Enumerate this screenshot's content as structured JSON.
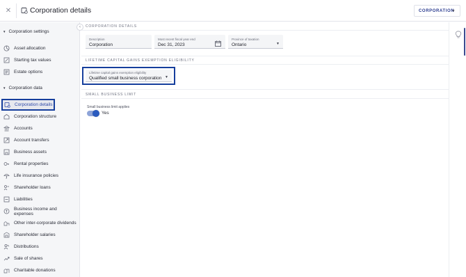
{
  "header": {
    "title": "Corporation details",
    "entity_select": "CORPORATION"
  },
  "sidebar": {
    "sections": [
      {
        "label": "Corporation settings",
        "items": [
          {
            "label": "Asset allocation",
            "icon": "asset-allocation-icon"
          },
          {
            "label": "Starting tax values",
            "icon": "tax-values-icon"
          },
          {
            "label": "Estate options",
            "icon": "estate-options-icon"
          }
        ]
      },
      {
        "label": "Corporation data",
        "items": [
          {
            "label": "Corporation details",
            "icon": "corporation-details-icon",
            "active": true
          },
          {
            "label": "Corporation structure",
            "icon": "structure-icon"
          },
          {
            "label": "Accounts",
            "icon": "accounts-icon"
          },
          {
            "label": "Account transfers",
            "icon": "transfers-icon"
          },
          {
            "label": "Business assets",
            "icon": "business-assets-icon"
          },
          {
            "label": "Rental properties",
            "icon": "rental-icon"
          },
          {
            "label": "Life insurance policies",
            "icon": "insurance-icon"
          },
          {
            "label": "Shareholder loans",
            "icon": "loans-icon"
          },
          {
            "label": "Liabilities",
            "icon": "liabilities-icon"
          },
          {
            "label": "Business income and expenses",
            "icon": "income-icon"
          },
          {
            "label": "Other inter-corporate dividends",
            "icon": "dividends-icon"
          },
          {
            "label": "Shareholder salaries",
            "icon": "salaries-icon"
          },
          {
            "label": "Distributions",
            "icon": "distributions-icon"
          },
          {
            "label": "Sale of shares",
            "icon": "sale-icon"
          },
          {
            "label": "Charitable donations",
            "icon": "donations-icon"
          }
        ]
      }
    ]
  },
  "main": {
    "corp_details": {
      "heading": "CORPORATION DETAILS",
      "description": {
        "label": "Description",
        "value": "Corporation"
      },
      "fiscal_year_end": {
        "label": "Most recent fiscal year end",
        "value": "Dec 31, 2023"
      },
      "province": {
        "label": "Province of taxation",
        "value": "Ontario"
      }
    },
    "lcge": {
      "heading": "LIFETIME CAPITAL GAINS EXEMPTION ELIGIBILITY",
      "eligibility": {
        "label": "Lifetime capital gains exemption eligibility",
        "value": "Qualified small business corporation"
      }
    },
    "sbl": {
      "heading": "SMALL BUSINESS LIMIT",
      "applies_label": "Small business limit applies",
      "applies_value": "Yes",
      "applies_on": true
    }
  },
  "colors": {
    "accent": "#153e9c",
    "active_text": "#2f4aa8",
    "sidebar_bg": "#f5f6f8"
  }
}
